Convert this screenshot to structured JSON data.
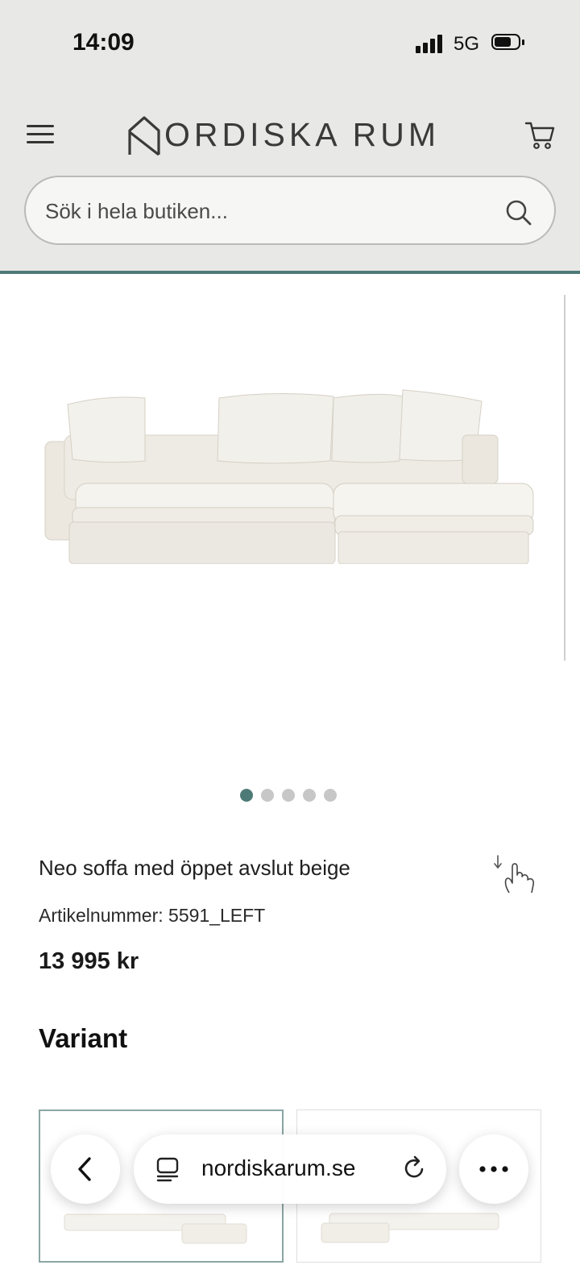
{
  "status_bar": {
    "time": "14:09",
    "network": "5G"
  },
  "header": {
    "brand": "NORDISKA RUM",
    "brand_rest": "ORDISKA RUM",
    "icons": [
      "menu-icon",
      "cart-icon"
    ],
    "accent_color": "#4d7a77"
  },
  "search": {
    "placeholder": "Sök i hela butiken...",
    "value": "",
    "icon": "search-icon"
  },
  "gallery": {
    "image": "sofa-image",
    "slide_count": 5,
    "active_slide": 1
  },
  "product": {
    "title": "Neo soffa med öppet avslut beige",
    "sku_label": "Artikelnummer:",
    "sku_value": "5591_LEFT",
    "price": "13 995 kr"
  },
  "variant": {
    "heading": "Variant",
    "options": [
      {
        "selected": true
      },
      {
        "selected": false
      }
    ]
  },
  "browser_bar": {
    "url": "nordiskarum.se",
    "icons": [
      "back-icon",
      "tab-icon",
      "reload-icon",
      "more-icon"
    ]
  }
}
